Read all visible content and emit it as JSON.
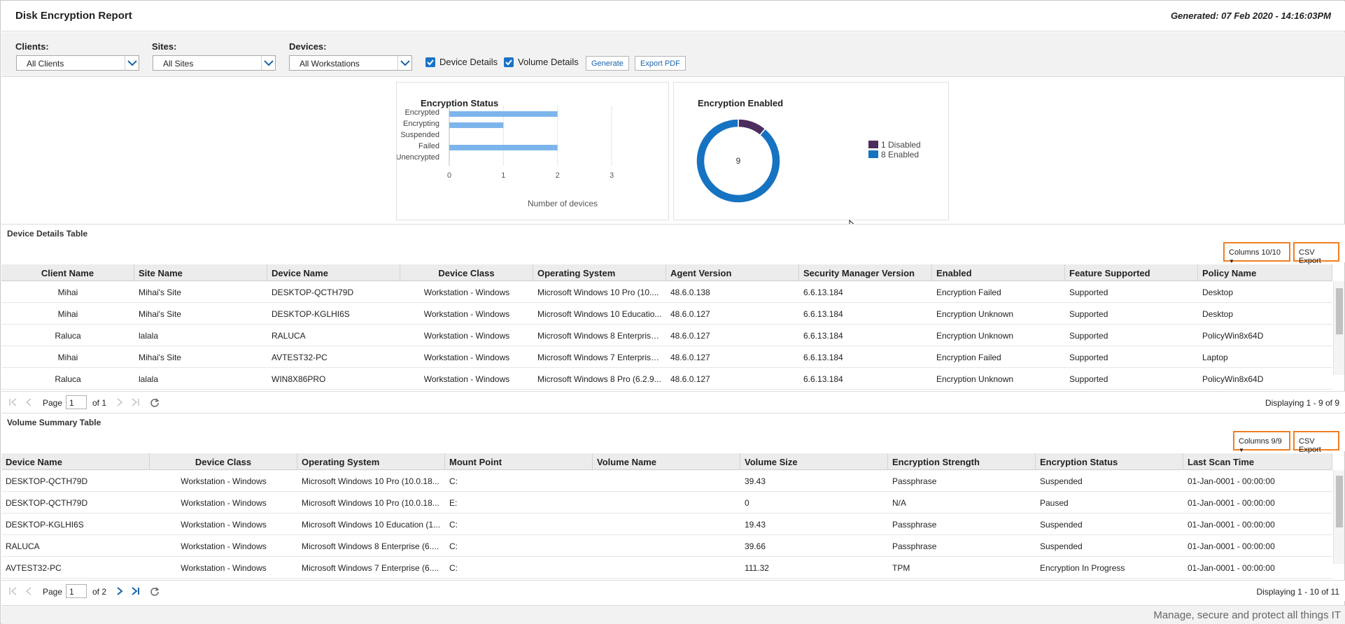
{
  "header": {
    "title": "Disk Encryption Report",
    "generated": "Generated: 07 Feb 2020 - 14:16:03PM"
  },
  "filters": {
    "clients_label": "Clients:",
    "clients_value": "All Clients",
    "sites_label": "Sites:",
    "sites_value": "All Sites",
    "devices_label": "Devices:",
    "devices_value": "All Workstations",
    "device_details_label": "Device Details",
    "volume_details_label": "Volume Details",
    "generate_label": "Generate",
    "export_pdf_label": "Export PDF"
  },
  "colors": {
    "bar": "#7cb5ec",
    "enabled": "#1673c2",
    "disabled": "#4d2d5c",
    "highlight": "#f07f22",
    "checkbox": "#1a73c8"
  },
  "chart_data": [
    {
      "type": "bar",
      "orientation": "horizontal",
      "title": "Encryption Status",
      "categories": [
        "Encrypted",
        "Encrypting",
        "Suspended",
        "Failed",
        "Unencrypted"
      ],
      "values": [
        2,
        1,
        0,
        2,
        0
      ],
      "xlabel": "Number of devices",
      "ylabel": "",
      "xlim": [
        0,
        3
      ],
      "xticks": [
        "0",
        "1",
        "2",
        "3"
      ],
      "grid": true
    },
    {
      "type": "pie",
      "variant": "donut",
      "title": "Encryption Enabled",
      "center_label": "9",
      "slices": [
        {
          "label": "Disabled",
          "legend": "1 Disabled",
          "value": 1
        },
        {
          "label": "Enabled",
          "legend": "8 Enabled",
          "value": 8
        }
      ],
      "legend_position": "right"
    }
  ],
  "device_section": {
    "title": "Device Details Table",
    "columns_btn": "Columns 10/10",
    "csv_btn": "CSV Export",
    "headers": [
      "Client Name",
      "Site Name",
      "Device Name",
      "Device Class",
      "Operating System",
      "Agent Version",
      "Security Manager Version",
      "Enabled",
      "Feature Supported",
      "Policy Name"
    ],
    "rows": [
      [
        "Mihai",
        "Mihai's Site",
        "DESKTOP-QCTH79D",
        "Workstation - Windows",
        "Microsoft Windows 10 Pro (10....",
        "48.6.0.138",
        "6.6.13.184",
        "Encryption Failed",
        "Supported",
        "Desktop"
      ],
      [
        "Mihai",
        "Mihai's Site",
        "DESKTOP-KGLHI6S",
        "Workstation - Windows",
        "Microsoft Windows 10 Educatio...",
        "48.6.0.127",
        "6.6.13.184",
        "Encryption Unknown",
        "Supported",
        "Desktop"
      ],
      [
        "Raluca",
        "lalala",
        "RALUCA",
        "Workstation - Windows",
        "Microsoft Windows 8 Enterprise...",
        "48.6.0.127",
        "6.6.13.184",
        "Encryption Unknown",
        "Supported",
        "PolicyWin8x64D"
      ],
      [
        "Mihai",
        "Mihai's Site",
        "AVTEST32-PC",
        "Workstation - Windows",
        "Microsoft Windows 7 Enterprise...",
        "48.6.0.127",
        "6.6.13.184",
        "Encryption Failed",
        "Supported",
        "Laptop"
      ],
      [
        "Raluca",
        "lalala",
        "WIN8X86PRO",
        "Workstation - Windows",
        "Microsoft Windows 8 Pro (6.2.9...",
        "48.6.0.127",
        "6.6.13.184",
        "Encryption Unknown",
        "Supported",
        "PolicyWin8x64D"
      ]
    ],
    "pager": {
      "page_label": "Page",
      "page": "1",
      "of": "of 1",
      "displaying": "Displaying 1 - 9 of 9"
    }
  },
  "volume_section": {
    "title": "Volume Summary Table",
    "columns_btn": "Columns 9/9",
    "csv_btn": "CSV Export",
    "headers": [
      "Device Name",
      "Device Class",
      "Operating System",
      "Mount Point",
      "Volume Name",
      "Volume Size",
      "Encryption Strength",
      "Encryption Status",
      "Last Scan Time"
    ],
    "rows": [
      [
        "DESKTOP-QCTH79D",
        "Workstation - Windows",
        "Microsoft Windows 10 Pro (10.0.18...",
        "C:",
        "",
        "39.43",
        "Passphrase",
        "Suspended",
        "01-Jan-0001 - 00:00:00"
      ],
      [
        "DESKTOP-QCTH79D",
        "Workstation - Windows",
        "Microsoft Windows 10 Pro (10.0.18...",
        "E:",
        "",
        "0",
        "N/A",
        "Paused",
        "01-Jan-0001 - 00:00:00"
      ],
      [
        "DESKTOP-KGLHI6S",
        "Workstation - Windows",
        "Microsoft Windows 10 Education (1...",
        "C:",
        "",
        "19.43",
        "Passphrase",
        "Suspended",
        "01-Jan-0001 - 00:00:00"
      ],
      [
        "RALUCA",
        "Workstation - Windows",
        "Microsoft Windows 8 Enterprise (6....",
        "C:",
        "",
        "39.66",
        "Passphrase",
        "Suspended",
        "01-Jan-0001 - 00:00:00"
      ],
      [
        "AVTEST32-PC",
        "Workstation - Windows",
        "Microsoft Windows 7 Enterprise (6....",
        "C:",
        "",
        "111.32",
        "TPM",
        "Encryption In Progress",
        "01-Jan-0001 - 00:00:00"
      ]
    ],
    "pager": {
      "page_label": "Page",
      "page": "1",
      "of": "of 2",
      "displaying": "Displaying 1 - 10 of 11"
    }
  },
  "footer": {
    "tagline": "Manage, secure and protect all things IT"
  }
}
